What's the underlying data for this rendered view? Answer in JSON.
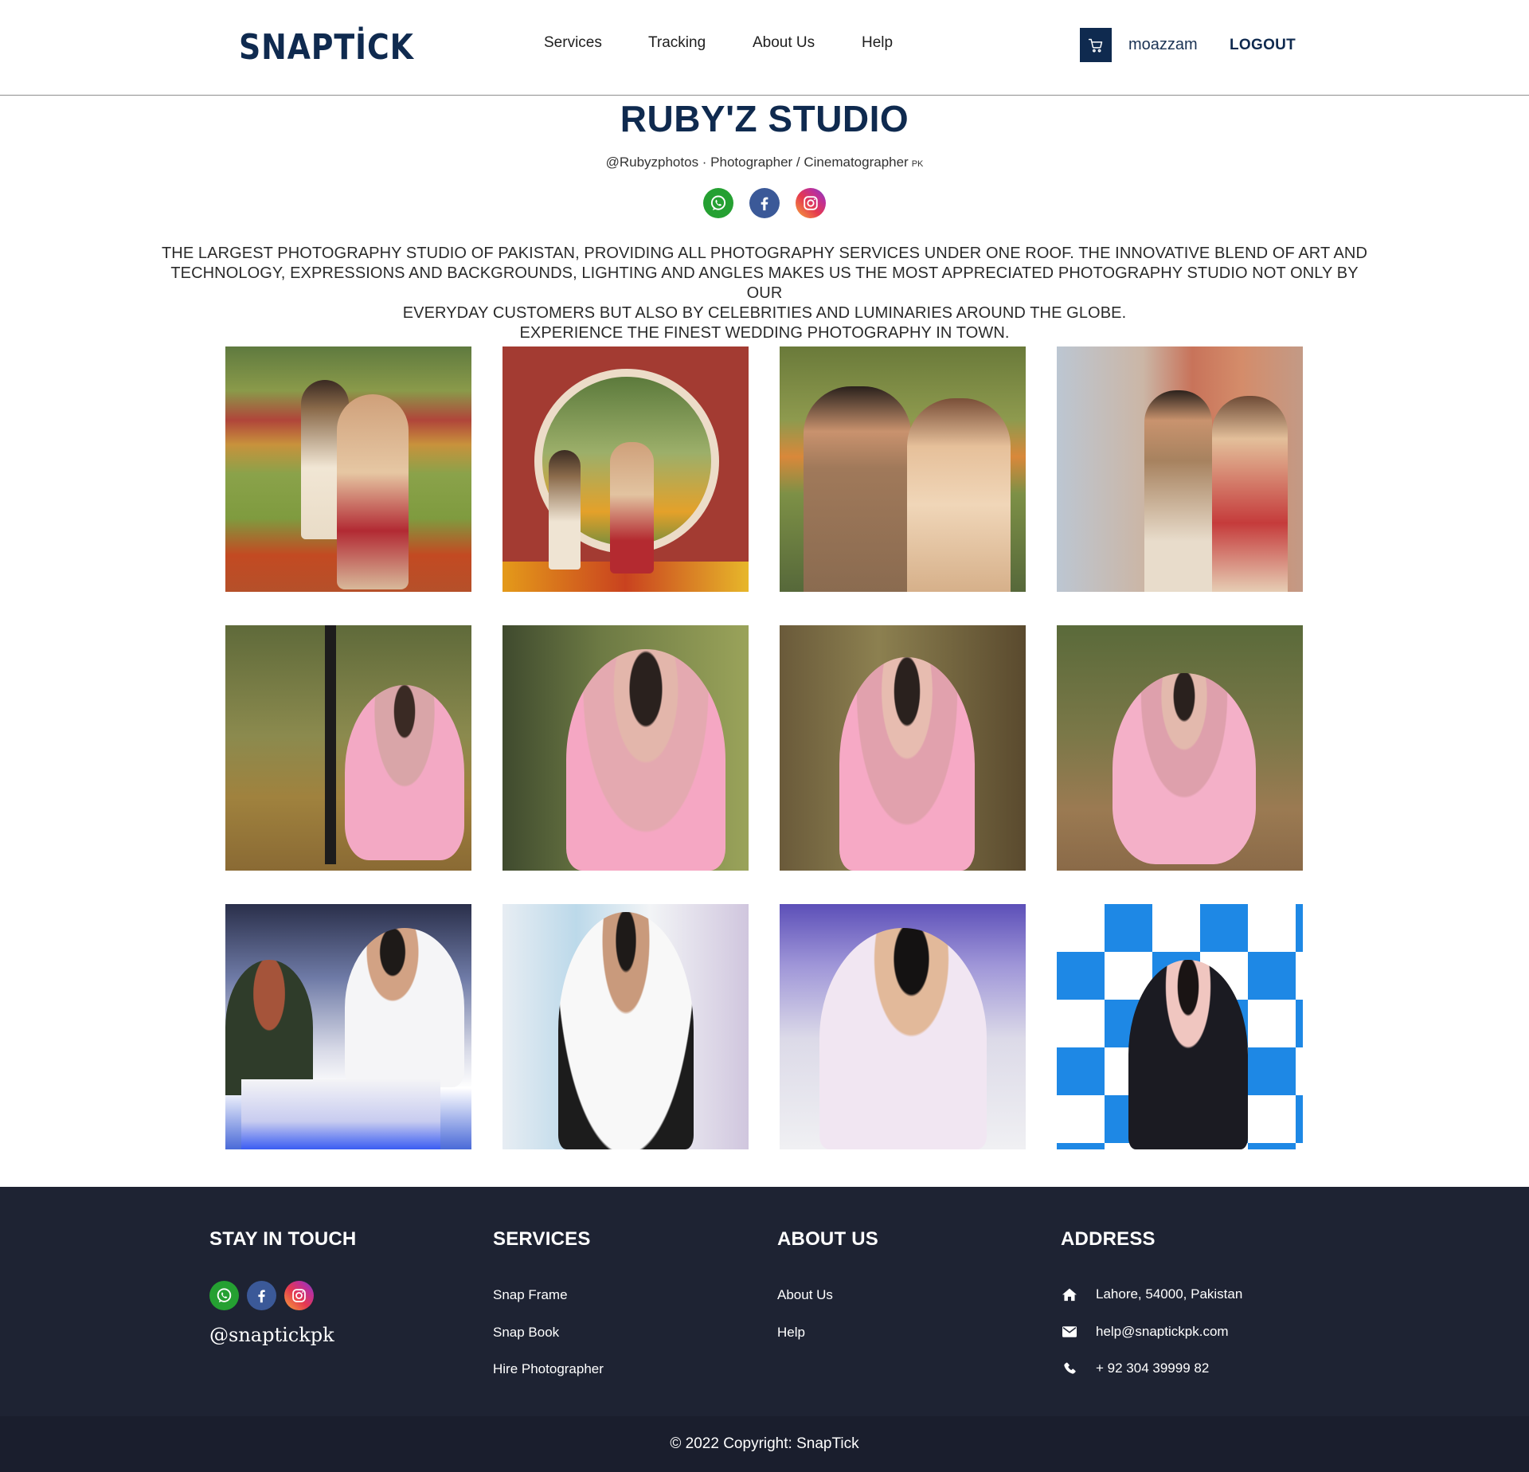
{
  "header": {
    "logo": "SNAPTİCK",
    "nav": [
      "Services",
      "Tracking",
      "About Us",
      "Help"
    ],
    "username": "moazzam",
    "logout_label": "LOGOUT",
    "cart_icon": "cart-icon"
  },
  "studio": {
    "title": "RUBY'Z STUDIO",
    "subtitle": "@Rubyzphotos · Photographer / Cinematographer",
    "country_code": "PK",
    "social_icons": [
      "whatsapp-icon",
      "facebook-icon",
      "instagram-icon"
    ],
    "description_lines": [
      "THE LARGEST PHOTOGRAPHY STUDIO OF PAKISTAN, PROVIDING ALL PHOTOGRAPHY SERVICES UNDER ONE ROOF. THE INNOVATIVE BLEND OF ART AND",
      "TECHNOLOGY, EXPRESSIONS AND BACKGROUNDS, LIGHTING AND ANGLES MAKES US THE MOST APPRECIATED PHOTOGRAPHY STUDIO NOT ONLY BY OUR",
      "EVERYDAY CUSTOMERS BUT ALSO BY CELEBRITIES AND LUMINARIES AROUND THE GLOBE.",
      "EXPERIENCE THE FINEST WEDDING PHOTOGRAPHY IN TOWN."
    ]
  },
  "gallery": {
    "rows": 3,
    "columns": 4,
    "photos": [
      {
        "name": "photo-1"
      },
      {
        "name": "photo-2"
      },
      {
        "name": "photo-3"
      },
      {
        "name": "photo-4"
      },
      {
        "name": "photo-5"
      },
      {
        "name": "photo-6"
      },
      {
        "name": "photo-7"
      },
      {
        "name": "photo-8"
      },
      {
        "name": "photo-9"
      },
      {
        "name": "photo-10"
      },
      {
        "name": "photo-11"
      },
      {
        "name": "photo-12"
      }
    ]
  },
  "footer": {
    "stay_in_touch": {
      "heading": "STAY IN TOUCH",
      "handle": "@snaptickpk",
      "social_icons": [
        "whatsapp-icon",
        "facebook-icon",
        "instagram-icon"
      ]
    },
    "services": {
      "heading": "SERVICES",
      "links": [
        "Snap Frame",
        "Snap Book",
        "Hire Photographer"
      ]
    },
    "about": {
      "heading": "ABOUT US",
      "links": [
        "About Us",
        "Help"
      ]
    },
    "address": {
      "heading": "ADDRESS",
      "location": "Lahore, 54000, Pakistan",
      "email": "help@snaptickpk.com",
      "phone": "+ 92 304 39999 82",
      "icons": [
        "home-icon",
        "envelope-icon",
        "phone-icon"
      ]
    },
    "copyright": "© 2022 Copyright: SnapTick"
  },
  "colors": {
    "brand_navy": "#0f2a4f",
    "footer_bg": "#1e2333",
    "copyright_bg": "#1a1e2d",
    "whatsapp": "#25a032",
    "facebook": "#3b5998"
  }
}
